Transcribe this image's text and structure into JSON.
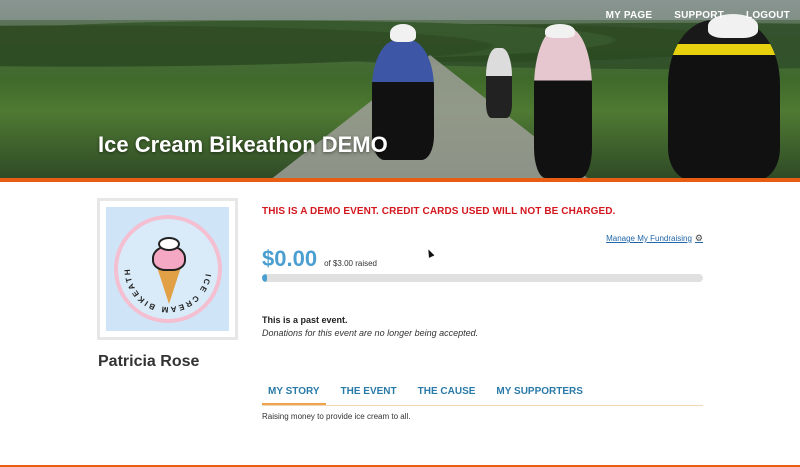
{
  "nav": {
    "my_page": "MY PAGE",
    "support": "SUPPORT",
    "logout": "LOGOUT"
  },
  "event": {
    "title": "Ice Cream Bikeathon DEMO",
    "demo_notice": "THIS IS A DEMO EVENT. CREDIT CARDS USED WILL NOT BE CHARGED."
  },
  "logo": {
    "text": "ICE CREAM BIKEATHON"
  },
  "fundraiser": {
    "name": "Patricia Rose",
    "manage_label": "Manage My Fundraising",
    "amount_raised": "$0.00",
    "goal_text": "of $3.00 raised",
    "progress_fraction": 0.0
  },
  "status": {
    "title": "This is a past event.",
    "subtitle": "Donations for this event are no longer being accepted."
  },
  "tabs": [
    {
      "label": "MY STORY",
      "active": true
    },
    {
      "label": "THE EVENT",
      "active": false
    },
    {
      "label": "THE CAUSE",
      "active": false
    },
    {
      "label": "MY SUPPORTERS",
      "active": false
    }
  ],
  "story_text": "Raising money to provide ice cream to all.",
  "colors": {
    "accent_orange": "#e85d12",
    "demo_red": "#d4171e",
    "amount_blue": "#4a9fd0",
    "tab_blue": "#2a7aa8"
  }
}
